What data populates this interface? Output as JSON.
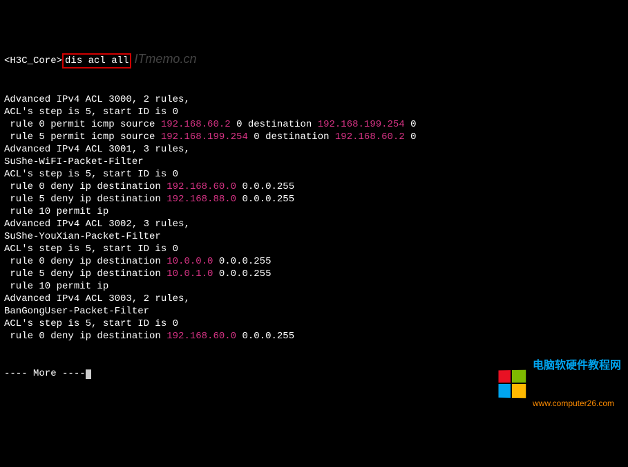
{
  "prompt_host": "<H3C_Core>",
  "command": "dis acl all",
  "top_watermark": "ITmemo.cn",
  "acls": [
    {
      "header": "Advanced IPv4 ACL 3000, 2 rules,",
      "name_line": "",
      "step_line": "ACL's step is 5, start ID is 0",
      "rules": [
        {
          "pre": " rule 0 permit icmp source ",
          "ip1": "192.168.60.2",
          "mid": " 0 destination ",
          "ip2": "192.168.199.254",
          "post": " 0"
        },
        {
          "pre": " rule 5 permit icmp source ",
          "ip1": "192.168.199.254",
          "mid": " 0 destination ",
          "ip2": "192.168.60.2",
          "post": " 0"
        }
      ]
    },
    {
      "header": "Advanced IPv4 ACL 3001, 3 rules,",
      "name_line": "SuShe-WiFI-Packet-Filter",
      "step_line": "ACL's step is 5, start ID is 0",
      "rules": [
        {
          "pre": " rule 0 deny ip destination ",
          "ip1": "192.168.60.0",
          "mid": " 0.0.0.255",
          "ip2": "",
          "post": ""
        },
        {
          "pre": " rule 5 deny ip destination ",
          "ip1": "192.168.88.0",
          "mid": " 0.0.0.255",
          "ip2": "",
          "post": ""
        },
        {
          "pre": " rule 10 permit ip",
          "ip1": "",
          "mid": "",
          "ip2": "",
          "post": ""
        }
      ]
    },
    {
      "header": "Advanced IPv4 ACL 3002, 3 rules,",
      "name_line": "SuShe-YouXian-Packet-Filter",
      "step_line": "ACL's step is 5, start ID is 0",
      "rules": [
        {
          "pre": " rule 0 deny ip destination ",
          "ip1": "10.0.0.0",
          "mid": " 0.0.0.255",
          "ip2": "",
          "post": ""
        },
        {
          "pre": " rule 5 deny ip destination ",
          "ip1": "10.0.1.0",
          "mid": " 0.0.0.255",
          "ip2": "",
          "post": ""
        },
        {
          "pre": " rule 10 permit ip",
          "ip1": "",
          "mid": "",
          "ip2": "",
          "post": ""
        }
      ]
    },
    {
      "header": "Advanced IPv4 ACL 3003, 2 rules,",
      "name_line": "BanGongUser-Packet-Filter",
      "step_line": "ACL's step is 5, start ID is 0",
      "rules": [
        {
          "pre": " rule 0 deny ip destination ",
          "ip1": "192.168.60.0",
          "mid": " 0.0.0.255",
          "ip2": "",
          "post": ""
        }
      ]
    }
  ],
  "more_prompt": "---- More ----",
  "logo_title": "电脑软硬件教程网",
  "logo_url": "www.computer26.com"
}
